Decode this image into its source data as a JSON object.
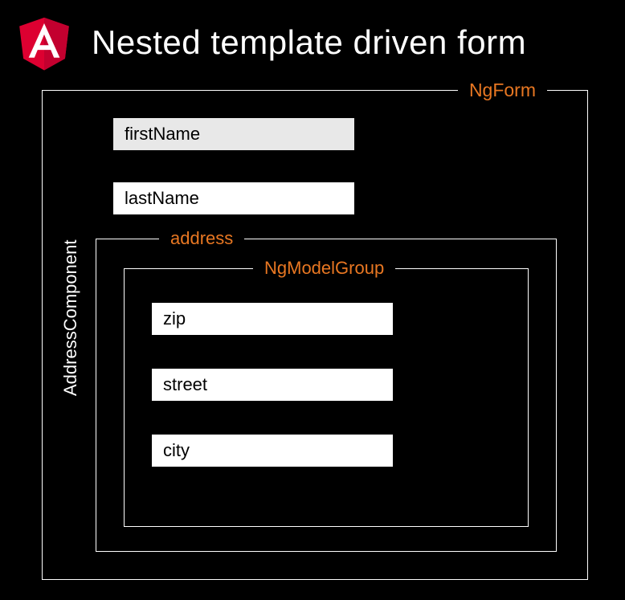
{
  "header": {
    "title": "Nested template driven form"
  },
  "form": {
    "ngFormLabel": "NgForm",
    "firstName": "firstName",
    "lastName": "lastName",
    "addressLabel": "address",
    "addressComponentLabel": "AddressComponent",
    "ngModelGroupLabel": "NgModelGroup",
    "zip": "zip",
    "street": "street",
    "city": "city"
  },
  "colors": {
    "accent": "#e87722",
    "background": "#000000",
    "text": "#ffffff",
    "fieldBg": "#ffffff",
    "fieldBgSelected": "#e8e8e8"
  }
}
